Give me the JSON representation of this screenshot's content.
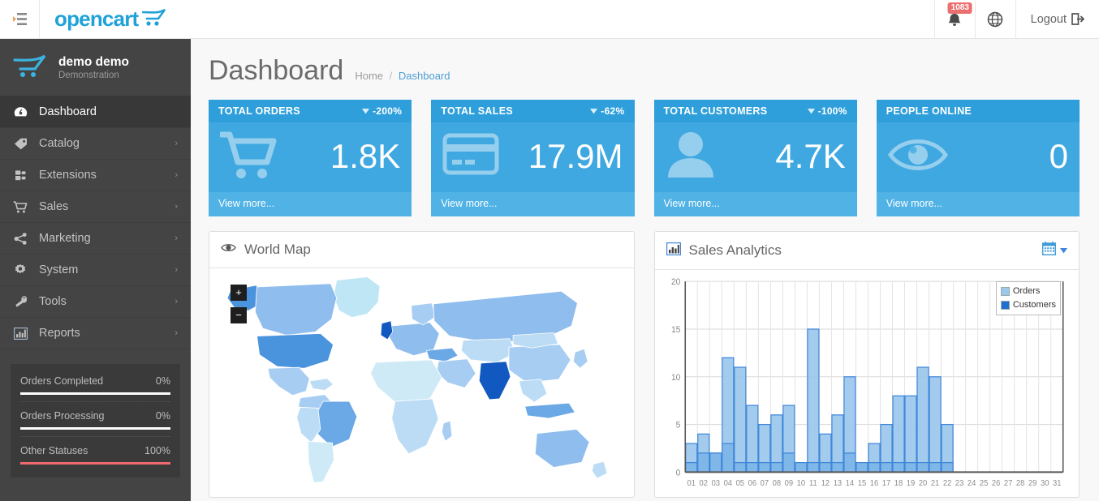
{
  "header": {
    "collapse_icon": "menu-collapse-icon",
    "brand": "opencart",
    "notifications": {
      "icon": "bell-icon",
      "count": "1083"
    },
    "language": {
      "icon": "globe-icon"
    },
    "logout": {
      "label": "Logout",
      "icon": "logout-icon"
    }
  },
  "sidebar": {
    "profile": {
      "name": "demo demo",
      "role": "Demonstration",
      "icon": "opencart-cart-icon"
    },
    "items": [
      {
        "label": "Dashboard",
        "icon": "dashboard-icon",
        "active": true,
        "caret": ""
      },
      {
        "label": "Catalog",
        "icon": "tag-icon",
        "active": false,
        "caret": "›"
      },
      {
        "label": "Extensions",
        "icon": "puzzle-icon",
        "active": false,
        "caret": "›"
      },
      {
        "label": "Sales",
        "icon": "cart-icon",
        "active": false,
        "caret": "›"
      },
      {
        "label": "Marketing",
        "icon": "share-icon",
        "active": false,
        "caret": "›"
      },
      {
        "label": "System",
        "icon": "gear-icon",
        "active": false,
        "caret": "›"
      },
      {
        "label": "Tools",
        "icon": "wrench-icon",
        "active": false,
        "caret": "›"
      },
      {
        "label": "Reports",
        "icon": "bar-chart-icon",
        "active": false,
        "caret": "›"
      }
    ],
    "stats": [
      {
        "label": "Orders Completed",
        "value": "0%",
        "pct": 0,
        "color": "#ffffff"
      },
      {
        "label": "Orders Processing",
        "value": "0%",
        "pct": 0,
        "color": "#ffffff"
      },
      {
        "label": "Other Statuses",
        "value": "100%",
        "pct": 100,
        "color": "#f0696e"
      }
    ]
  },
  "page": {
    "title": "Dashboard",
    "breadcrumb": {
      "home": "Home",
      "sep": "/",
      "current": "Dashboard"
    }
  },
  "tiles": [
    {
      "title": "TOTAL ORDERS",
      "pct": "-200%",
      "trend": "down",
      "value": "1.8K",
      "icon": "shopping-cart-icon",
      "footer": "View more..."
    },
    {
      "title": "TOTAL SALES",
      "pct": "-62%",
      "trend": "down",
      "value": "17.9M",
      "icon": "credit-card-icon",
      "footer": "View more..."
    },
    {
      "title": "TOTAL CUSTOMERS",
      "pct": "-100%",
      "trend": "down",
      "value": "4.7K",
      "icon": "user-icon",
      "footer": "View more..."
    },
    {
      "title": "PEOPLE ONLINE",
      "pct": "",
      "trend": "",
      "value": "0",
      "icon": "eye-icon",
      "footer": "View more..."
    }
  ],
  "world_map": {
    "title": "World Map",
    "icon": "eye-icon",
    "zoom_in": "+",
    "zoom_out": "−",
    "palette": [
      "#cfeaf7",
      "#bcdcf5",
      "#a8cdf2",
      "#8fbdee",
      "#6ba8e6",
      "#3f86da",
      "#1158c0"
    ]
  },
  "sales_analytics": {
    "title": "Sales Analytics",
    "icon": "bar-chart-icon",
    "calendar_icon": "calendar-icon",
    "caret_icon": "chevron-down-icon"
  },
  "chart_data": {
    "type": "bar",
    "title": "Sales Analytics",
    "xlabel": "",
    "ylabel": "",
    "ylim": [
      0,
      20
    ],
    "yticks": [
      0,
      5,
      10,
      15,
      20
    ],
    "grid": true,
    "legend_position": "top-right",
    "categories": [
      "01",
      "02",
      "03",
      "04",
      "05",
      "06",
      "07",
      "08",
      "09",
      "10",
      "11",
      "12",
      "13",
      "14",
      "15",
      "16",
      "17",
      "18",
      "19",
      "20",
      "21",
      "22",
      "23",
      "24",
      "25",
      "26",
      "27",
      "28",
      "29",
      "30",
      "31"
    ],
    "series": [
      {
        "name": "Orders",
        "color": "#9dc8ec",
        "values": [
          3,
          4,
          2,
          12,
          11,
          7,
          5,
          6,
          7,
          1,
          15,
          4,
          6,
          10,
          1,
          3,
          5,
          8,
          8,
          11,
          10,
          5,
          0,
          0,
          0,
          0,
          0,
          0,
          0,
          0,
          0
        ]
      },
      {
        "name": "Customers",
        "color": "#1d6fd0",
        "values": [
          1,
          2,
          2,
          3,
          1,
          1,
          1,
          1,
          2,
          1,
          1,
          1,
          1,
          2,
          1,
          1,
          1,
          1,
          1,
          1,
          1,
          1,
          0,
          0,
          0,
          0,
          0,
          0,
          0,
          0,
          0
        ]
      }
    ]
  }
}
